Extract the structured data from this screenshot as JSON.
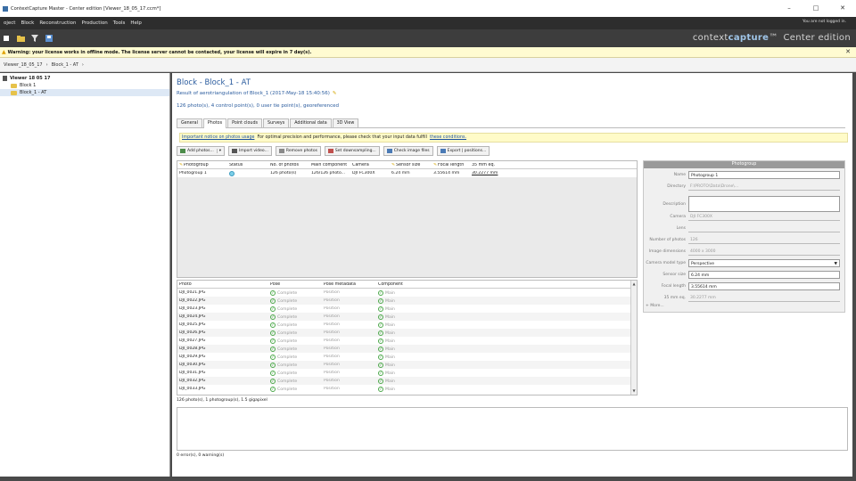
{
  "window": {
    "title": "ContextCapture Master - Center edition [Viewer_18_05_17.ccm*]",
    "controls": [
      "–",
      "□",
      "✕"
    ]
  },
  "menu": {
    "items": [
      "oject",
      "Block",
      "Reconstruction",
      "Production",
      "Tools",
      "Help"
    ],
    "login_text": "You are not logged in.",
    "signin_label": " "
  },
  "brand": {
    "name_a": "context",
    "name_b": "capture",
    "tm": "™",
    "edition": "Center edition"
  },
  "warning": {
    "text": "Warning: your license works in offline mode. The license server cannot be contacted, your license will expire in 7 day(s).",
    "close": "✕"
  },
  "breadcrumb": [
    "Viewer_18_05_17",
    "›",
    "Block_1 - AT",
    "›"
  ],
  "tree": {
    "project": "Viewer 18 05 17",
    "block": "Block 1",
    "at": "Block_1 - AT"
  },
  "main": {
    "title": "Block - Block_1 - AT",
    "subtitle": "Result of aerotriangulation of Block_1 (2017-May-18 15:40:56)",
    "stats": "126 photo(s), 4 control point(s), 0 user tie point(s), georeferenced",
    "tabs": [
      "General",
      "Photos",
      "Point clouds",
      "Surveys",
      "Additional data",
      "3D View"
    ],
    "info_link": "Important notice on photos usage",
    "info_text": "For optimal precision and performance, please check that your input data fulfill",
    "info_link2": "these conditions.",
    "actions": [
      "Add photos...",
      "Import video...",
      "Remove photos",
      "Set downsampling...",
      "Check image files",
      "Export | positions..."
    ]
  },
  "photogroups": {
    "columns": [
      "Photogroup",
      "Status",
      "No. of photos",
      "Main component",
      "Camera",
      "Sensor size",
      "Focal length",
      "35 mm eq."
    ],
    "rows": [
      [
        "Photogroup 1",
        "",
        "126 photo(s)",
        "126/126 photo...",
        "DJI FC300X",
        "6.24 mm",
        "3.55614 mm",
        "30.2277 mm"
      ]
    ]
  },
  "photos": {
    "columns": [
      "Photo",
      "Pose",
      "Pose metadata",
      "Component"
    ],
    "rows": [
      [
        "DJI_0021.JPG",
        "Complete",
        "Position",
        "Main"
      ],
      [
        "DJI_0022.JPG",
        "Complete",
        "Position",
        "Main"
      ],
      [
        "DJI_0023.JPG",
        "Complete",
        "Position",
        "Main"
      ],
      [
        "DJI_0024.JPG",
        "Complete",
        "Position",
        "Main"
      ],
      [
        "DJI_0025.JPG",
        "Complete",
        "Position",
        "Main"
      ],
      [
        "DJI_0026.JPG",
        "Complete",
        "Position",
        "Main"
      ],
      [
        "DJI_0027.JPG",
        "Complete",
        "Position",
        "Main"
      ],
      [
        "DJI_0028.JPG",
        "Complete",
        "Position",
        "Main"
      ],
      [
        "DJI_0029.JPG",
        "Complete",
        "Position",
        "Main"
      ],
      [
        "DJI_0030.JPG",
        "Complete",
        "Position",
        "Main"
      ],
      [
        "DJI_0031.JPG",
        "Complete",
        "Position",
        "Main"
      ],
      [
        "DJI_0032.JPG",
        "Complete",
        "Position",
        "Main"
      ],
      [
        "DJI_0033.JPG",
        "Complete",
        "Position",
        "Main"
      ]
    ]
  },
  "properties": {
    "header": "Photogroup",
    "name_label": "Name",
    "name_value": "Photogroup 1",
    "directory_label": "Directory",
    "directory_value": "F:\\PROTO\\Data\\Drone\\...",
    "description_label": "Description",
    "description_value": "",
    "camera_label": "Camera",
    "camera_value": "DJI FC300X",
    "lens_label": "Lens",
    "lens_value": "",
    "nphotos_label": "Number of photos",
    "nphotos_value": "126",
    "imgdim_label": "Image dimensions",
    "imgdim_value": "4000 x 3000",
    "model_label": "Camera model type",
    "model_value": "Perspective",
    "sensor_label": "Sensor size",
    "sensor_value": "6.24 mm",
    "focal_label": "Focal length",
    "focal_value": "3.55614 mm",
    "eq_label": "35 mm eq.",
    "eq_value": "30.2277 mm",
    "more": "+ More..."
  },
  "footer": {
    "summary": "126 photo(s), 1 photogroup(s), 1.5 gigapixel",
    "errors": "0 error(s), 0 warning(s)"
  }
}
